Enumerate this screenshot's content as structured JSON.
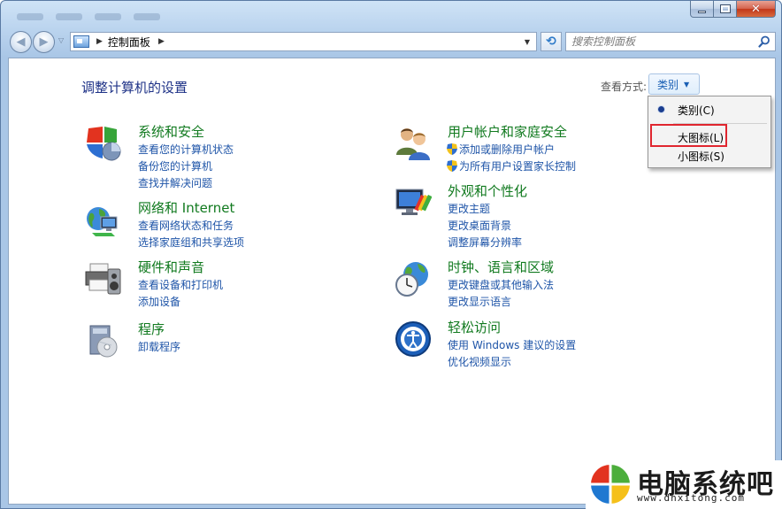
{
  "address_bar": {
    "breadcrumb": "控制面板",
    "search_placeholder": "搜索控制面板"
  },
  "header": {
    "title": "调整计算机的设置",
    "view_by_label": "查看方式:",
    "view_by_value": "类别"
  },
  "view_menu": {
    "items": [
      {
        "label": "类别(C)",
        "selected": true
      },
      {
        "label": "大图标(L)",
        "selected": false,
        "highlighted": true
      },
      {
        "label": "小图标(S)",
        "selected": false
      }
    ]
  },
  "categories_left": [
    {
      "title": "系统和安全",
      "icon": "shield-pie-icon",
      "links": [
        "查看您的计算机状态",
        "备份您的计算机",
        "查找并解决问题"
      ]
    },
    {
      "title": "网络和 Internet",
      "icon": "network-globe-icon",
      "links": [
        "查看网络状态和任务",
        "选择家庭组和共享选项"
      ]
    },
    {
      "title": "硬件和声音",
      "icon": "printer-speaker-icon",
      "links": [
        "查看设备和打印机",
        "添加设备"
      ]
    },
    {
      "title": "程序",
      "icon": "programs-disc-icon",
      "links": [
        "卸载程序"
      ]
    }
  ],
  "categories_right": [
    {
      "title": "用户帐户和家庭安全",
      "icon": "users-icon",
      "links": [
        "添加或删除用户帐户",
        "为所有用户设置家长控制"
      ]
    },
    {
      "title": "外观和个性化",
      "icon": "monitor-paint-icon",
      "links": [
        "更改主题",
        "更改桌面背景",
        "调整屏幕分辨率"
      ]
    },
    {
      "title": "时钟、语言和区域",
      "icon": "clock-globe-icon",
      "links": [
        "更改键盘或其他输入法",
        "更改显示语言"
      ]
    },
    {
      "title": "轻松访问",
      "icon": "ease-of-access-icon",
      "links": [
        "使用 Windows 建议的设置",
        "优化视频显示"
      ]
    }
  ],
  "watermark": {
    "text": "电脑系统吧",
    "url": "www.dnxitong.com"
  },
  "colors": {
    "category_title": "#117a1f",
    "link": "#1f55a8",
    "page_title": "#1e3287",
    "highlight": "#e0262f"
  }
}
